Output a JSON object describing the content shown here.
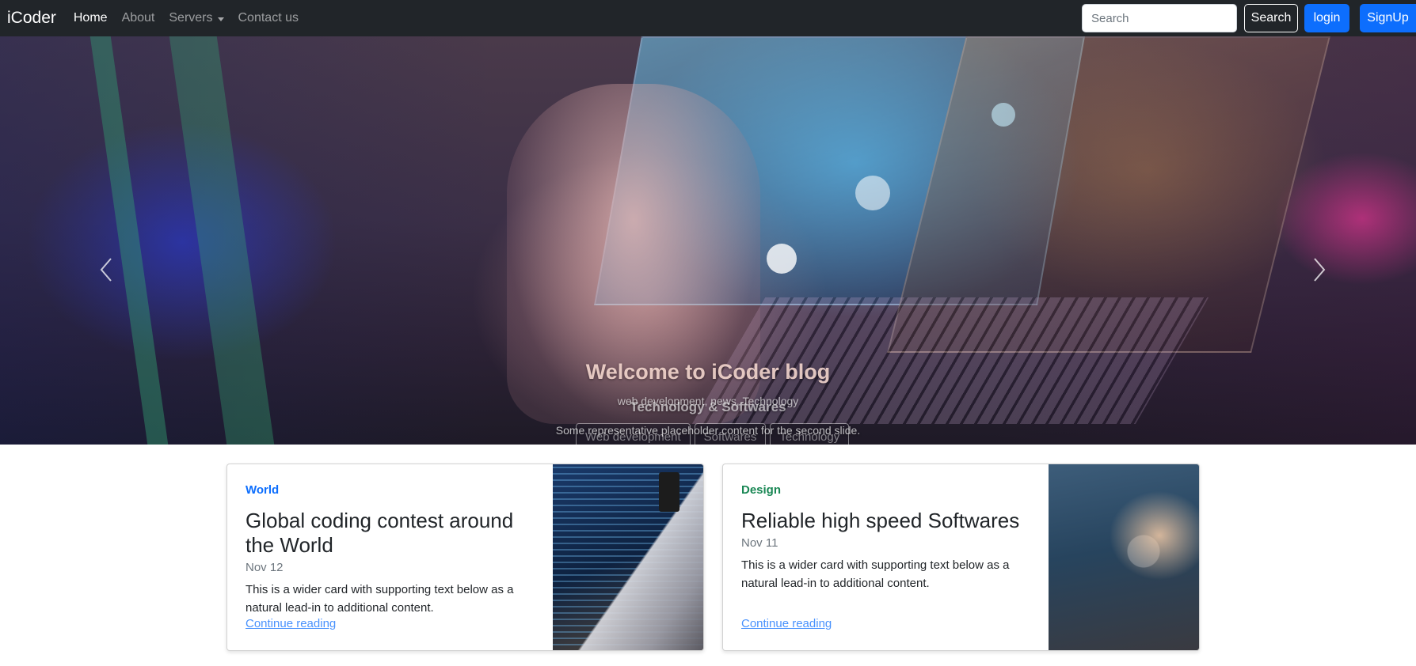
{
  "navbar": {
    "brand": "iCoder",
    "links": [
      {
        "label": "Home",
        "active": true
      },
      {
        "label": "About",
        "active": false
      },
      {
        "label": "Servers",
        "active": false,
        "dropdown": true
      },
      {
        "label": "Contact us",
        "active": false
      }
    ],
    "search_placeholder": "Search",
    "search_button": "Search",
    "login_button": "login",
    "signup_button": "SignUp"
  },
  "carousel": {
    "slide1": {
      "title": "Welcome to iCoder blog",
      "subtitle": "web development, news, Technology",
      "buttons": [
        "Web development",
        "Softwares",
        "Technology"
      ]
    },
    "slide2": {
      "title": "Technology & Softwares",
      "text": "Some representative placeholder content for the second slide."
    },
    "active_indicator": 2,
    "indicator_count": 3
  },
  "cards": [
    {
      "category": "World",
      "title": "Global coding contest around the World",
      "date": "Nov 12",
      "text": "This is a wider card with supporting text below as a natural lead-in to additional content.",
      "link": "Continue reading"
    },
    {
      "category": "Design",
      "title": "Reliable high speed Softwares",
      "date": "Nov 11",
      "text": "This is a wider card with supporting text below as a natural lead-in to additional content.",
      "link": "Continue reading"
    }
  ],
  "colors": {
    "navbar_bg": "#212529",
    "primary": "#0d6efd",
    "success": "#198754",
    "muted": "#6c757d"
  }
}
